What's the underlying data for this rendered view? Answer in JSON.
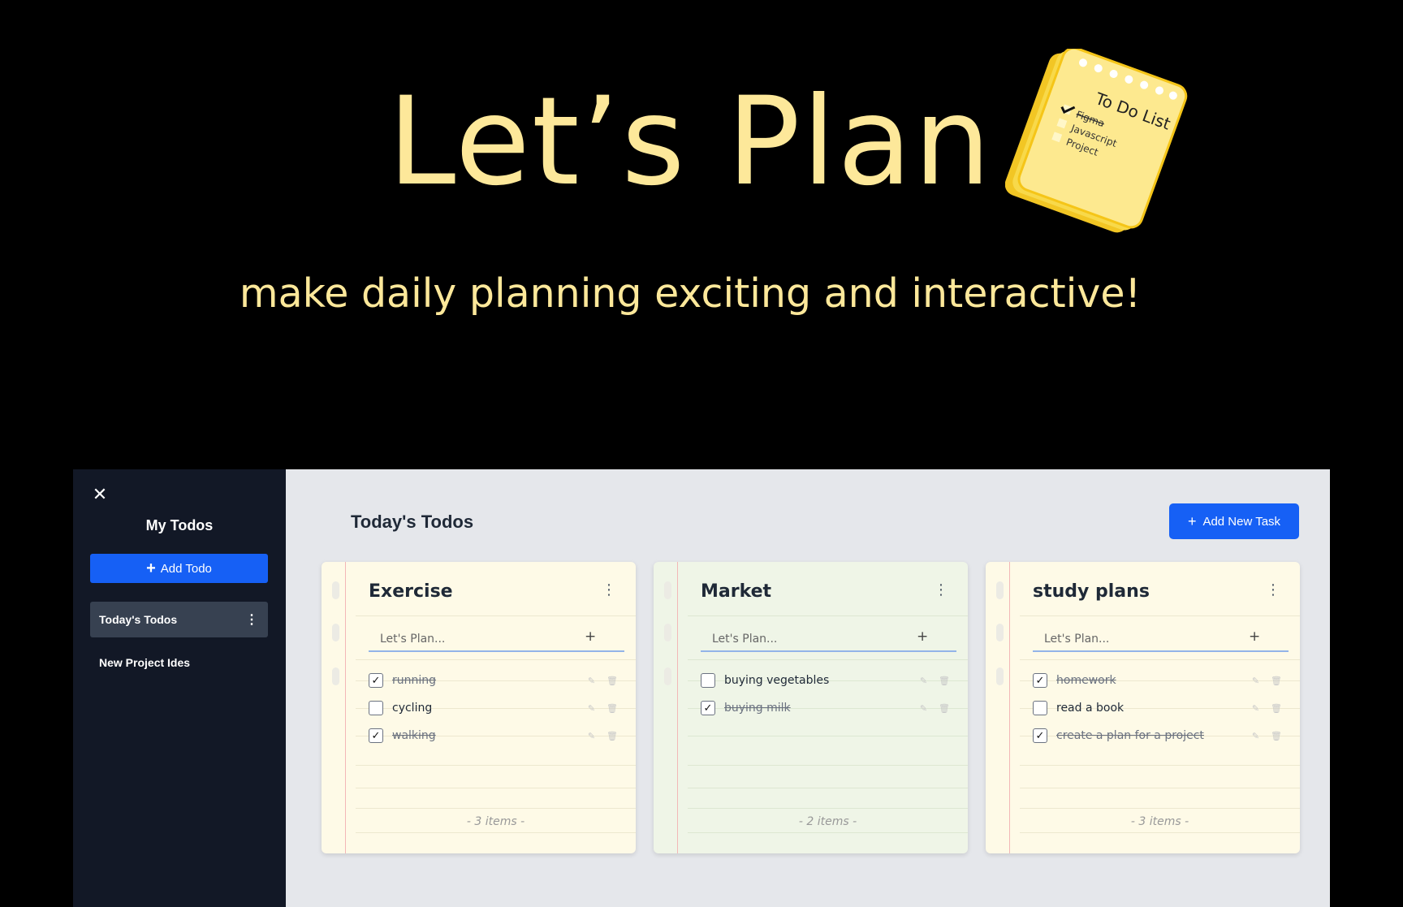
{
  "hero": {
    "title": "Let’s Plan",
    "subtitle": "make daily planning exciting and interactive!",
    "notepad": {
      "heading": "To Do List",
      "items": [
        "Figma",
        "Javascript",
        "Project"
      ]
    }
  },
  "sidebar": {
    "title": "My Todos",
    "add_label": "Add Todo",
    "items": [
      {
        "label": "Today's Todos",
        "active": true
      },
      {
        "label": "New Project Ides",
        "active": false
      }
    ]
  },
  "main": {
    "title": "Today's Todos",
    "add_task_label": "Add New Task"
  },
  "cards": [
    {
      "title": "Exercise",
      "placeholder": "Let's Plan...",
      "color": "#fefae7",
      "tasks": [
        {
          "text": "running",
          "done": true
        },
        {
          "text": "cycling",
          "done": false
        },
        {
          "text": "walking",
          "done": true
        }
      ],
      "footer": "- 3 items -"
    },
    {
      "title": "Market",
      "placeholder": "Let's Plan...",
      "color": "#eff5e7",
      "tasks": [
        {
          "text": "buying vegetables",
          "done": false
        },
        {
          "text": "buying milk",
          "done": true
        }
      ],
      "footer": "- 2 items -"
    },
    {
      "title": "study plans",
      "placeholder": "Let's Plan...",
      "color": "#fefae7",
      "tasks": [
        {
          "text": "homework",
          "done": true
        },
        {
          "text": "read a book",
          "done": false
        },
        {
          "text": "create a plan for a project",
          "done": true
        }
      ],
      "footer": "- 3 items -"
    }
  ],
  "colors": {
    "accent": "#1660f5",
    "hero_text": "#fde89a",
    "sidebar_bg": "#121826"
  }
}
